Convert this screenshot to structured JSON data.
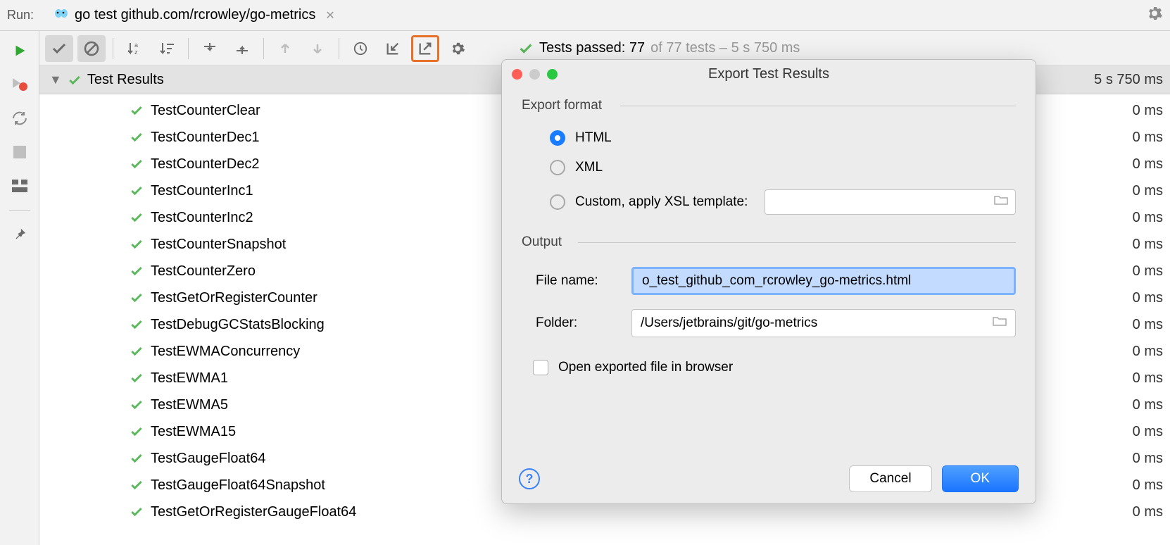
{
  "topbar": {
    "run_label": "Run:",
    "tab_title": "go test github.com/rcrowley/go-metrics"
  },
  "status": {
    "prefix": "Tests passed: 77",
    "suffix": "of 77 tests – 5 s 750 ms"
  },
  "results": {
    "header_label": "Test Results",
    "header_time": "5 s 750 ms",
    "tests": [
      {
        "name": "TestCounterClear",
        "dur": "0 ms"
      },
      {
        "name": "TestCounterDec1",
        "dur": "0 ms"
      },
      {
        "name": "TestCounterDec2",
        "dur": "0 ms"
      },
      {
        "name": "TestCounterInc1",
        "dur": "0 ms"
      },
      {
        "name": "TestCounterInc2",
        "dur": "0 ms"
      },
      {
        "name": "TestCounterSnapshot",
        "dur": "0 ms"
      },
      {
        "name": "TestCounterZero",
        "dur": "0 ms"
      },
      {
        "name": "TestGetOrRegisterCounter",
        "dur": "0 ms"
      },
      {
        "name": "TestDebugGCStatsBlocking",
        "dur": "0 ms"
      },
      {
        "name": "TestEWMAConcurrency",
        "dur": "0 ms"
      },
      {
        "name": "TestEWMA1",
        "dur": "0 ms"
      },
      {
        "name": "TestEWMA5",
        "dur": "0 ms"
      },
      {
        "name": "TestEWMA15",
        "dur": "0 ms"
      },
      {
        "name": "TestGaugeFloat64",
        "dur": "0 ms"
      },
      {
        "name": "TestGaugeFloat64Snapshot",
        "dur": "0 ms"
      },
      {
        "name": "TestGetOrRegisterGaugeFloat64",
        "dur": "0 ms"
      }
    ]
  },
  "dialog": {
    "title": "Export Test Results",
    "section_format": "Export format",
    "radio_html": "HTML",
    "radio_xml": "XML",
    "radio_custom": "Custom, apply XSL template:",
    "section_output": "Output",
    "label_filename": "File name:",
    "value_filename": "o_test_github_com_rcrowley_go-metrics.html",
    "label_folder": "Folder:",
    "value_folder": "/Users/jetbrains/git/go-metrics",
    "checkbox_label": "Open exported file in browser",
    "btn_cancel": "Cancel",
    "btn_ok": "OK",
    "help": "?"
  }
}
